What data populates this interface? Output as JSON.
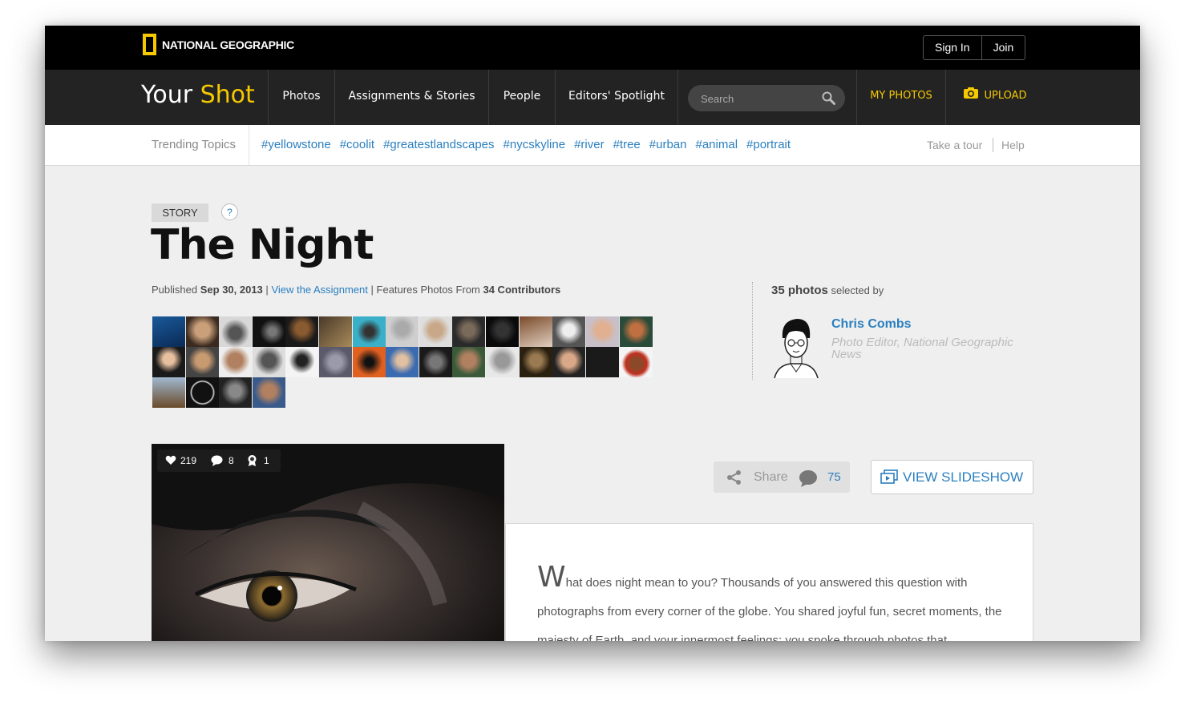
{
  "header": {
    "logo_text": "NATIONAL GEOGRAPHIC",
    "sign_in": "Sign In",
    "join": "Join"
  },
  "nav": {
    "brand_your": "Your",
    "brand_shot": "Shot",
    "items": [
      "Photos",
      "Assignments & Stories",
      "People",
      "Editors' Spotlight"
    ],
    "search_placeholder": "Search",
    "my_photos": "MY PHOTOS",
    "upload": "UPLOAD"
  },
  "trending": {
    "label": "Trending Topics",
    "tags": [
      "#yellowstone",
      "#coolit",
      "#greatestlandscapes",
      "#nycskyline",
      "#river",
      "#tree",
      "#urban",
      "#animal",
      "#portrait"
    ],
    "tour": "Take a tour",
    "help": "Help"
  },
  "story": {
    "badge": "STORY",
    "help_icon": "?",
    "title": "The Night",
    "published_label": "Published",
    "published_date": "Sep 30, 2013",
    "sep1": "|",
    "assignment_link": "View the Assignment",
    "sep2": "|",
    "features_text": "Features Photos From",
    "contributors": "34 Contributors"
  },
  "curator": {
    "photo_count": "35 photos",
    "selected_by": "selected by",
    "name": "Chris Combs",
    "title": "Photo Editor, National Geographic News"
  },
  "photo": {
    "likes": "219",
    "comments": "8",
    "awards": "1"
  },
  "actions": {
    "share": "Share",
    "comment_count": "75",
    "view_slideshow": "VIEW SLIDESHOW"
  },
  "article": {
    "dropcap": "W",
    "text": "hat does night mean to you? Thousands of you answered this question with photographs from every corner of the globe. You shared joyful fun, secret moments, the majesty of Earth, and your innermost feelings; you spoke through photos that"
  },
  "colors": {
    "accent": "#f5c800",
    "link": "#2a7fbf"
  }
}
